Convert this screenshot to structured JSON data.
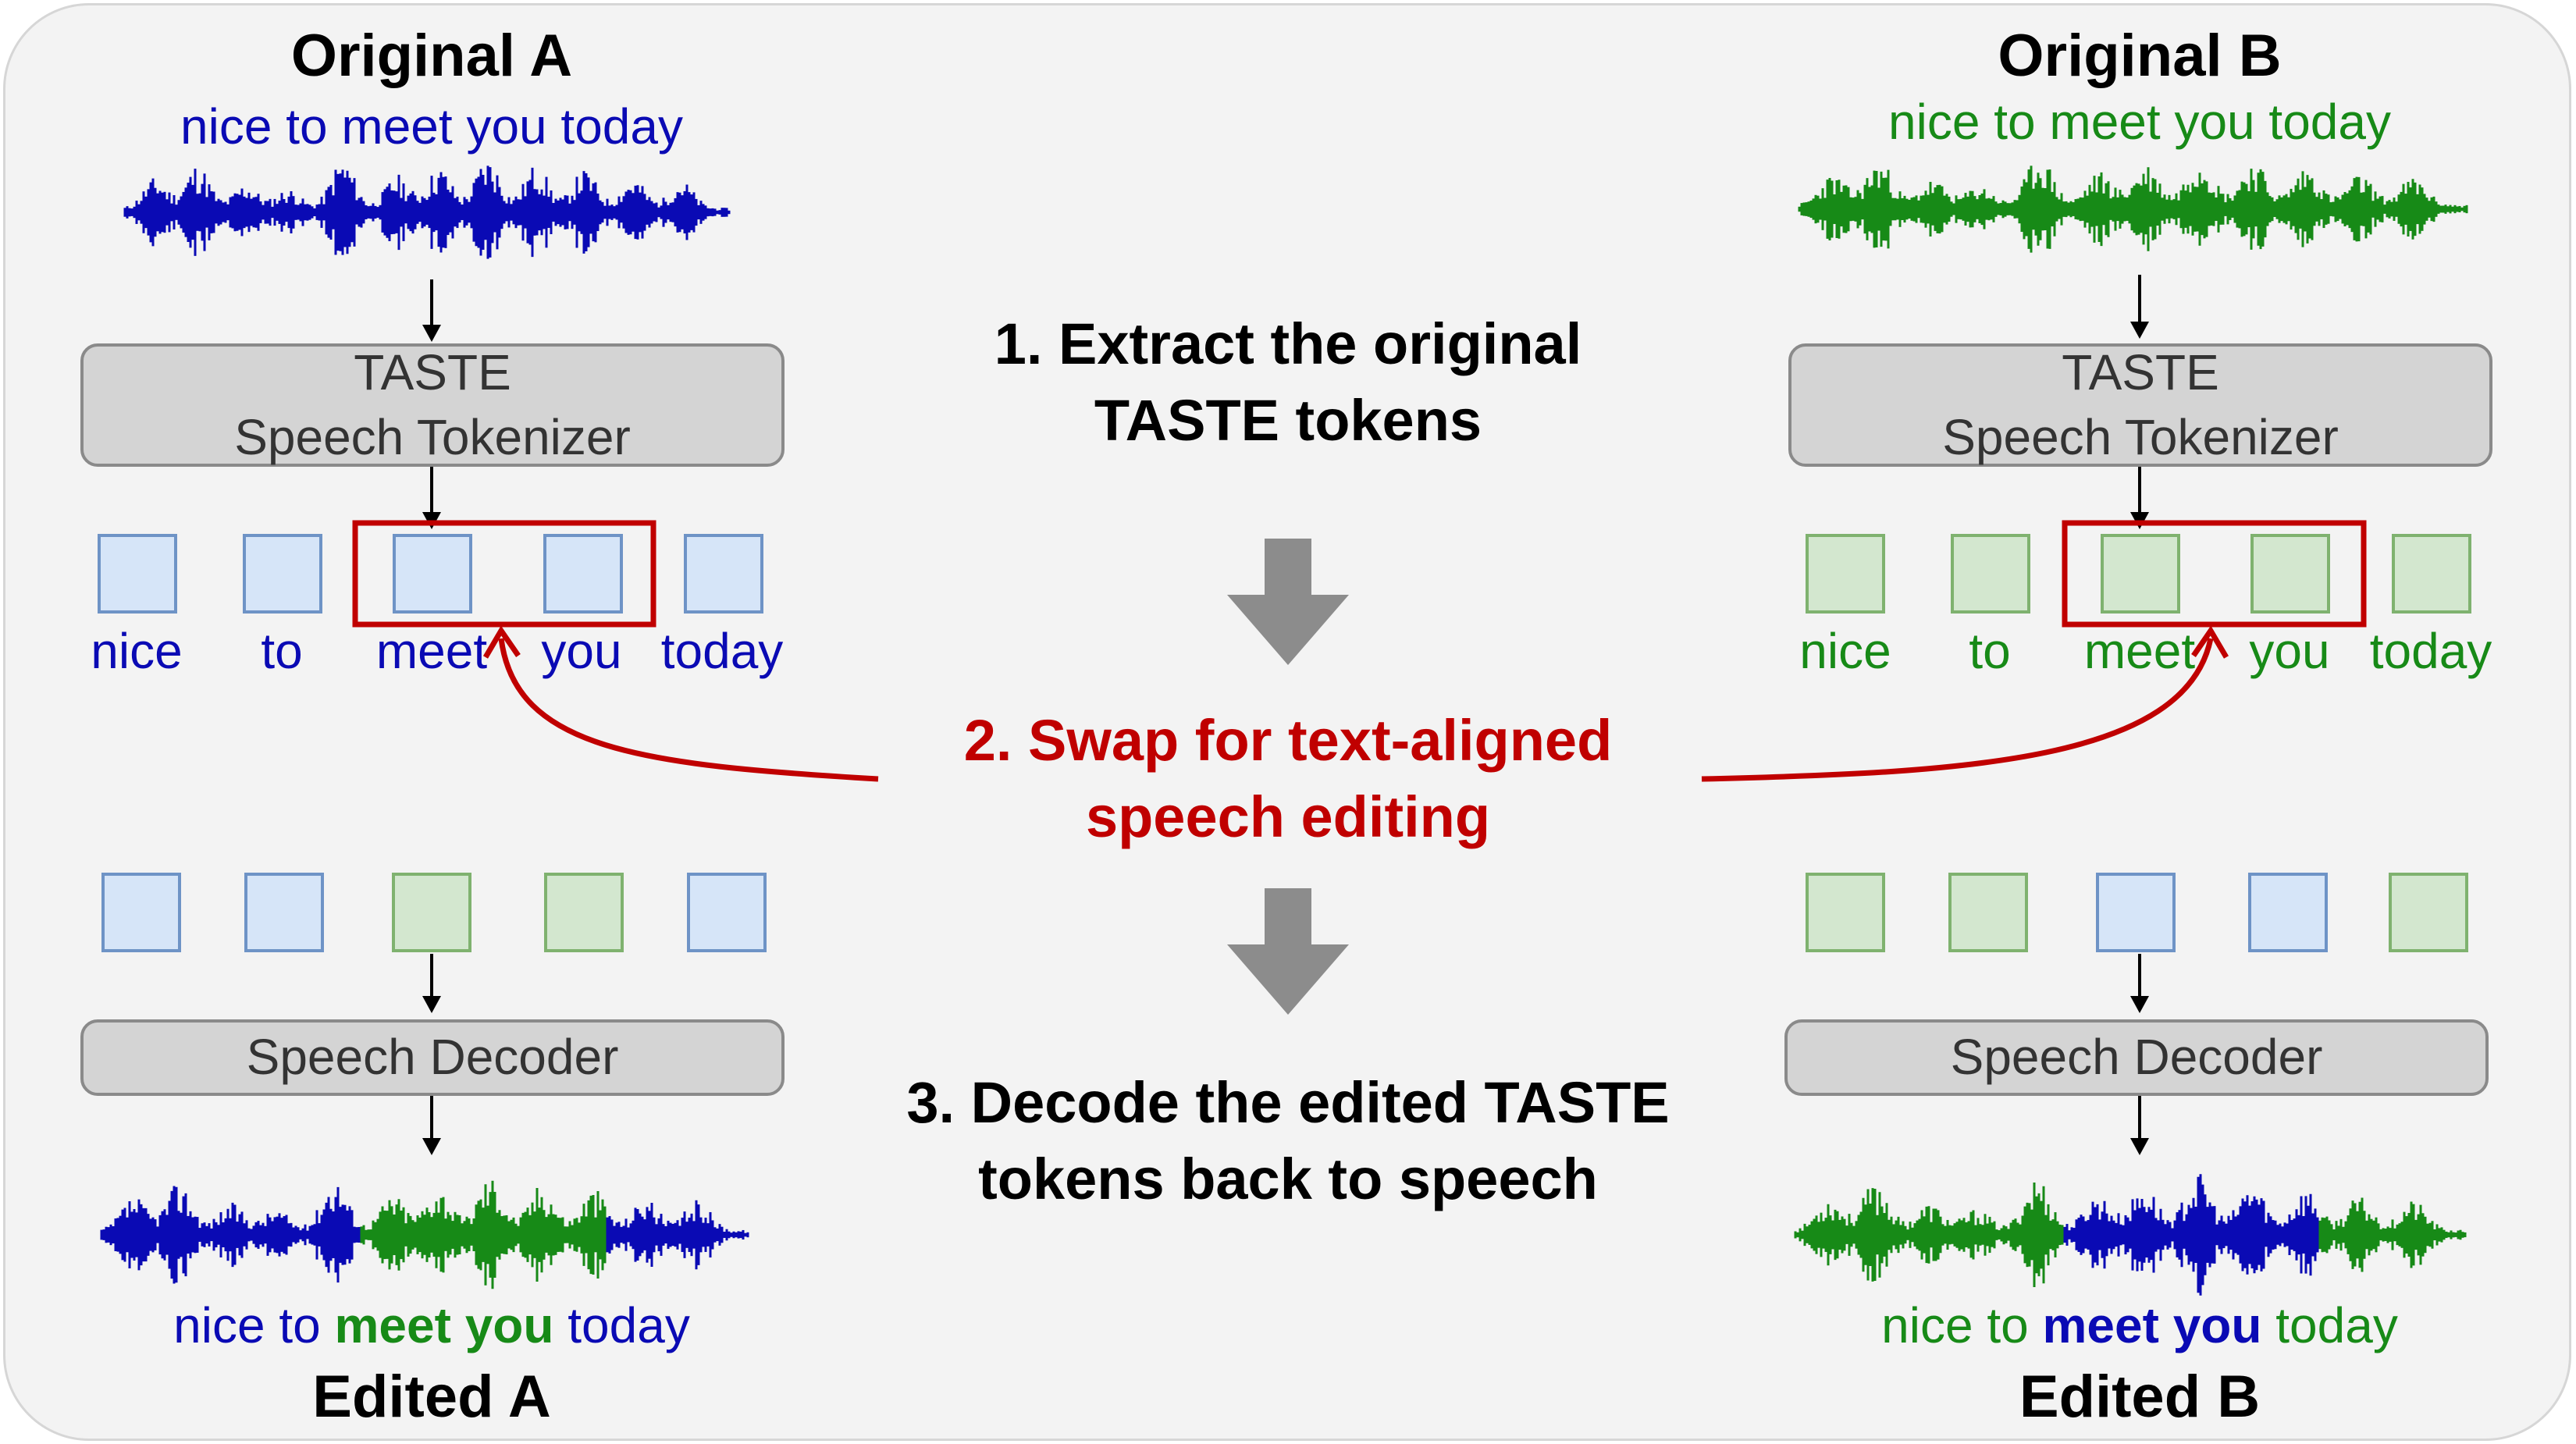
{
  "left": {
    "title": "Original A",
    "transcript": "nice to meet you today",
    "tokenizer": {
      "line1": "TASTE",
      "line2": "Speech Tokenizer"
    },
    "tokens": [
      "nice",
      "to",
      "meet",
      "you",
      "today"
    ],
    "decoder": "Speech Decoder",
    "edited": {
      "pre": "nice to",
      "swapped": "meet you",
      "post": "today"
    },
    "result_title": "Edited A"
  },
  "right": {
    "title": "Original B",
    "transcript": "nice to meet you today",
    "tokenizer": {
      "line1": "TASTE",
      "line2": "Speech Tokenizer"
    },
    "tokens": [
      "nice",
      "to",
      "meet",
      "you",
      "today"
    ],
    "decoder": "Speech Decoder",
    "edited": {
      "pre": "nice to",
      "swapped": "meet you",
      "post": "today"
    },
    "result_title": "Edited B"
  },
  "steps": {
    "step1": [
      "1. Extract the original",
      "TASTE tokens"
    ],
    "step2": [
      "2. Swap for text-aligned",
      "speech editing"
    ],
    "step3": [
      "3. Decode the edited TASTE",
      "tokens back to speech"
    ]
  },
  "colors": {
    "speaker_a": "#0a0ab4",
    "speaker_b": "#178a17",
    "highlight": "#c00000",
    "token_a_fill": "#d6e5f8",
    "token_b_fill": "#d3e7cf",
    "module_fill": "#d4d4d4",
    "arrow_gray": "#8c8c8c"
  }
}
